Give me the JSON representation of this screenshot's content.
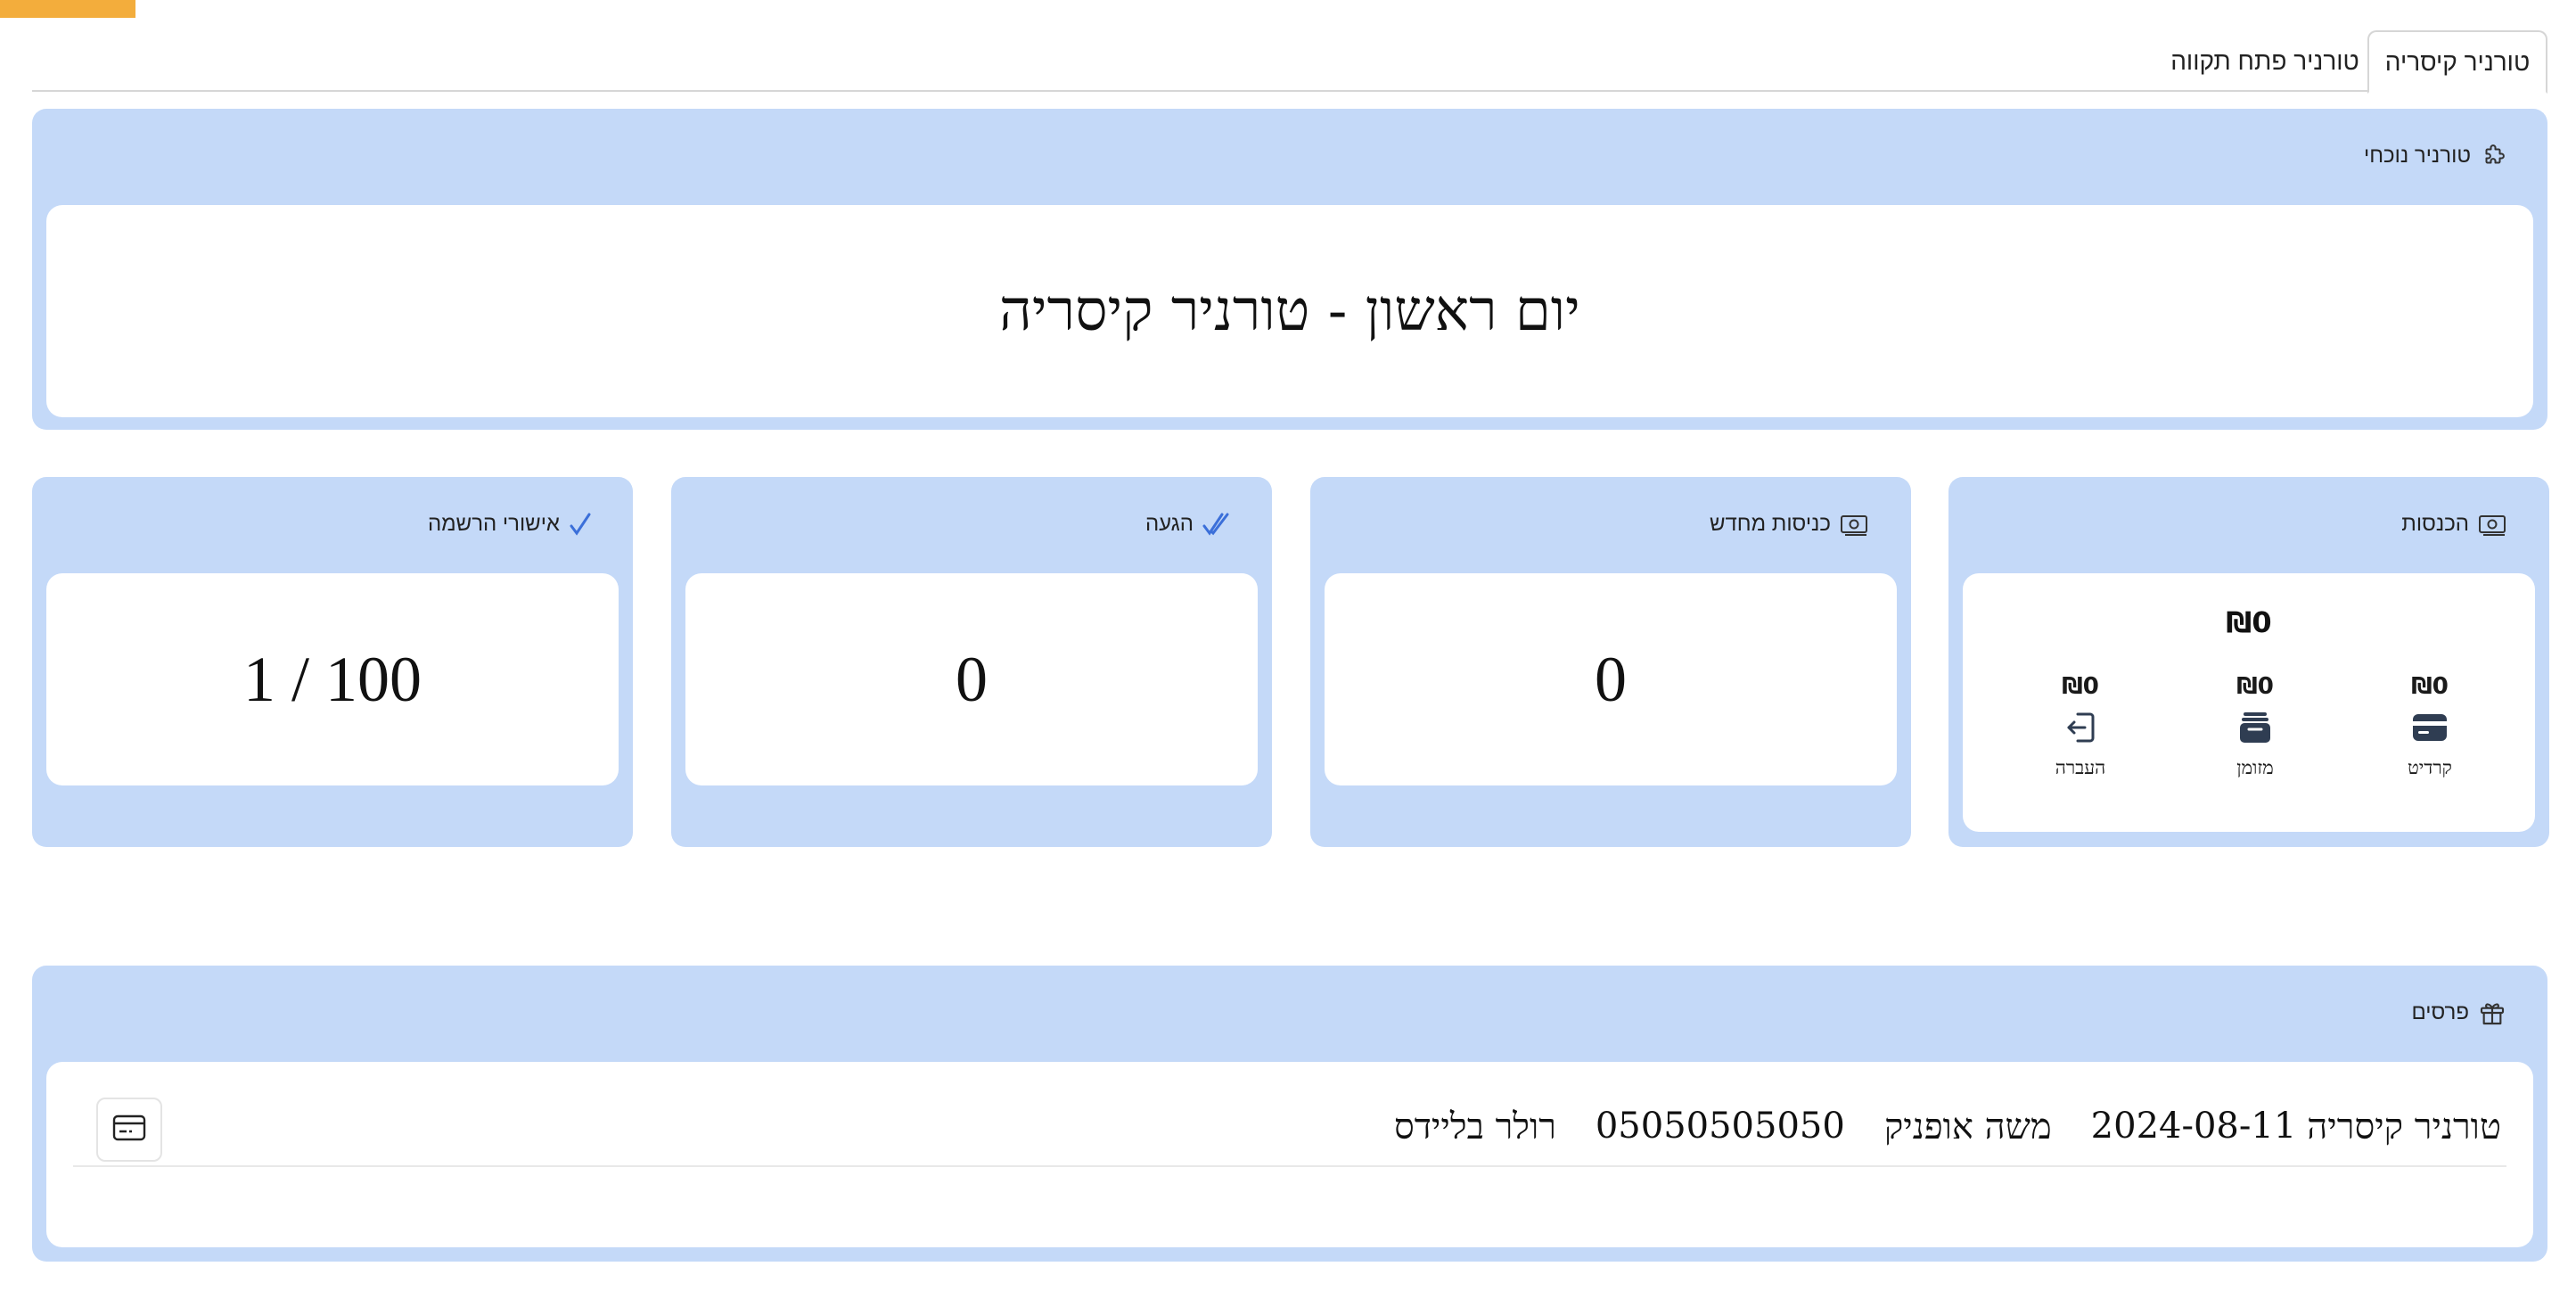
{
  "tabs": [
    {
      "label": "טורניר קיסריה",
      "active": true
    },
    {
      "label": "טורניר פתח תקווה",
      "active": false
    }
  ],
  "current_tournament": {
    "header": "טורניר נוכחי",
    "title": "יום ראשון - טורניר קיסריה"
  },
  "income": {
    "header": "הכנסות",
    "total": "₪0",
    "methods": [
      {
        "label": "קרדיט",
        "amount": "₪0",
        "icon": "credit-card-icon"
      },
      {
        "label": "מזומן",
        "amount": "₪0",
        "icon": "wallet-icon"
      },
      {
        "label": "העברה",
        "amount": "₪0",
        "icon": "transfer-icon"
      }
    ]
  },
  "new_entries": {
    "header": "כניסות מחדש",
    "value": "0"
  },
  "arrival": {
    "header": "הגעה",
    "value": "0"
  },
  "registration": {
    "header": "אישורי הרשמה",
    "value": "100 / 1"
  },
  "prizes": {
    "header": "פרסים",
    "rows": [
      {
        "tournament": "טורניר קיסריה",
        "date": "2024-08-11",
        "name": "משה אופניק",
        "phone": "05050505050",
        "prize": "רולר בליידס"
      }
    ]
  },
  "colors": {
    "panel": "#c4d9f8",
    "accent_badge": "#f3ad3c",
    "check": "#3b6fd9"
  }
}
